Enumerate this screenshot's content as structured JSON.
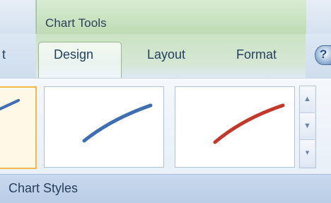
{
  "ribbon": {
    "context_group": "Chart Tools",
    "tabs": [
      {
        "label": "t"
      },
      {
        "label": "Design",
        "active": true
      },
      {
        "label": "Layout"
      },
      {
        "label": "Format"
      }
    ],
    "help_icon": "help-icon"
  },
  "gallery": {
    "group_label": "Chart Styles",
    "styles": [
      {
        "color": "#3f6fb0",
        "selected": true
      },
      {
        "color": "#3f6fb0"
      },
      {
        "color": "#c0392b"
      }
    ],
    "scroll_up_icon": "▲",
    "scroll_down_icon": "▼",
    "more_icon": "▾"
  },
  "colors": {
    "context_green": "#bedcb4",
    "selected_border": "#f2b94a"
  }
}
